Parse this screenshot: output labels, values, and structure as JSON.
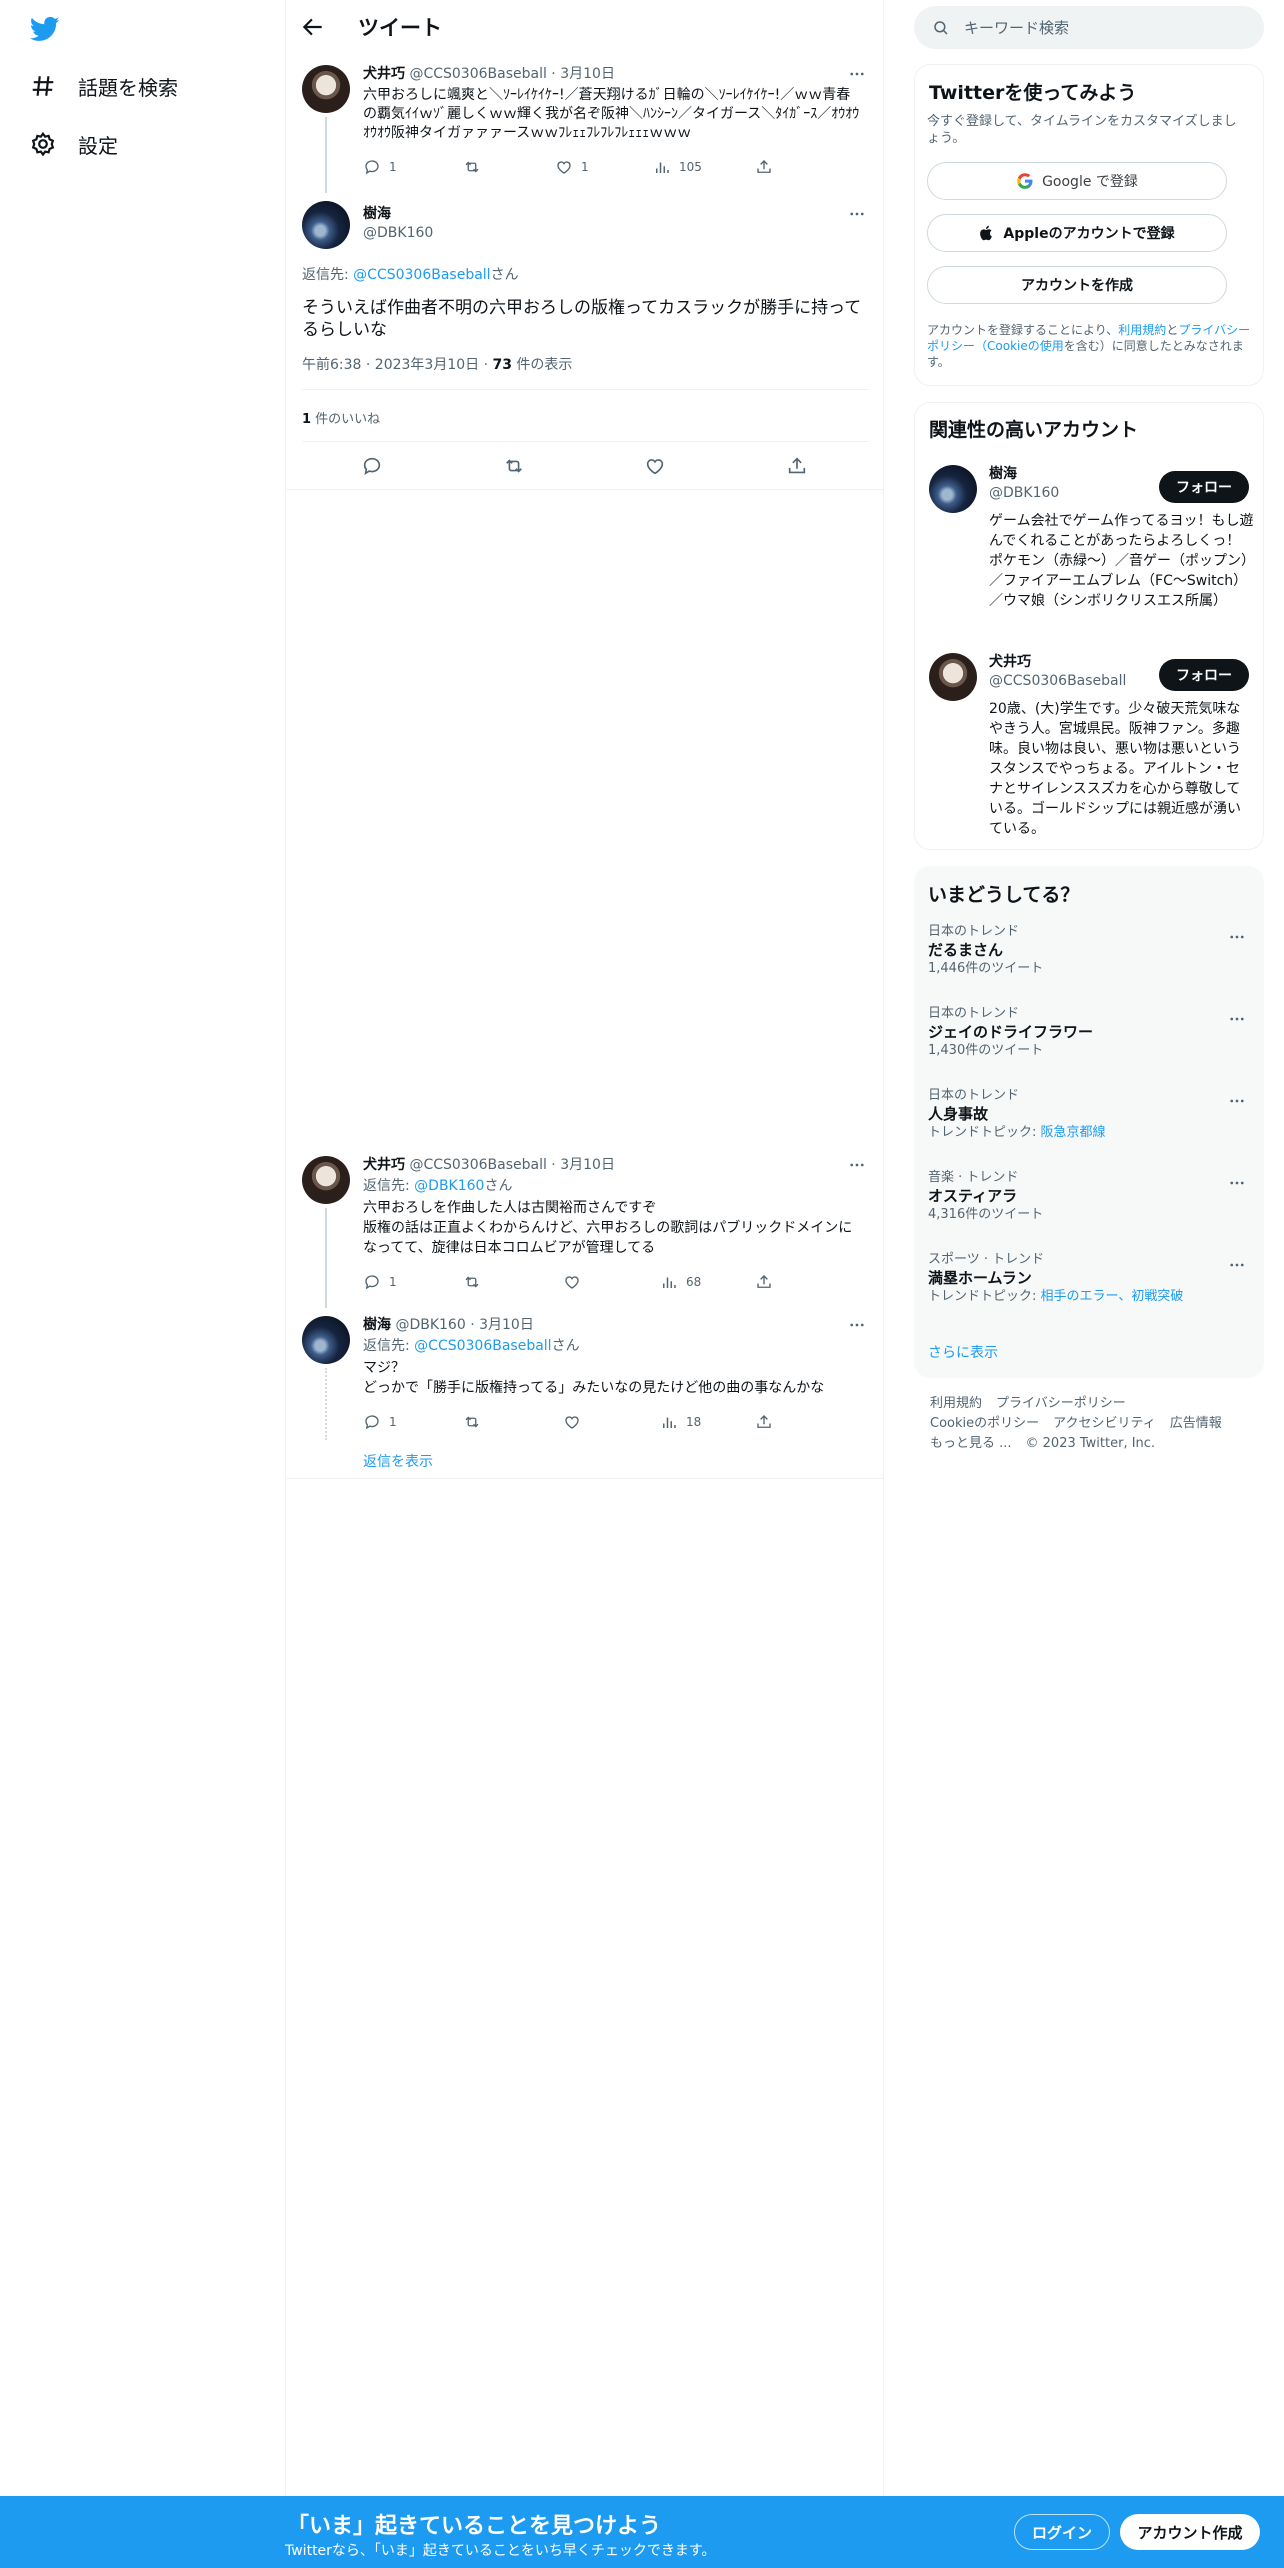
{
  "nav": {
    "search_label": "話題を検索",
    "settings_label": "設定"
  },
  "header": {
    "title": "ツイート"
  },
  "search": {
    "placeholder": "キーワード検索"
  },
  "parent_tweet": {
    "name": "犬井巧",
    "handle": "@CCS0306Baseball",
    "date": "3月10日",
    "text": "六甲おろしに颯爽と＼ｿｰﾚｲｹｲｹｰ!／蒼天翔けるｶﾞ日輪の＼ｿｰﾚｲｹｲｹｰ!／ｗｗ青春の覇気ｲｲｗｿﾞ麗しくｗｗ輝く我が名ぞ阪神＼ﾊﾝｼｰﾝ／タイガース＼ﾀｲｶﾞｰｽ／ｵｳｵｳｵｳｵｳ阪神タイガァァァースｗｗﾌﾚｪｪﾌﾚﾌﾚﾌﾚｪｪｪｗｗｗ",
    "reply_count": "1",
    "like_count": "1",
    "views": "105"
  },
  "main_tweet": {
    "name": "樹海",
    "handle": "@DBK160",
    "reply_prefix": "返信先: ",
    "reply_to": "@CCS0306Baseball",
    "reply_suffix": "さん",
    "text": "そういえば作曲者不明の六甲おろしの版権ってカスラックが勝手に持ってるらしいな",
    "time": "午前6:38 · 2023年3月10日 · ",
    "views_count": "73",
    "views_label": " 件の表示",
    "likes_count": "1",
    "likes_label": " 件のいいね"
  },
  "replies": [
    {
      "name": "犬井巧",
      "handle": "@CCS0306Baseball",
      "date": "3月10日",
      "reply_prefix": "返信先: ",
      "reply_to": "@DBK160",
      "reply_suffix": "さん",
      "text": "六甲おろしを作曲した人は古関裕而さんですぞ\n版権の話は正直よくわからんけど、六甲おろしの歌詞はパブリックドメインになってて、旋律は日本コロムビアが管理してる",
      "reply_count": "1",
      "views": "68"
    },
    {
      "name": "樹海",
      "handle": "@DBK160",
      "date": "3月10日",
      "reply_prefix": "返信先: ",
      "reply_to": "@CCS0306Baseball",
      "reply_suffix": "さん",
      "text": "マジ？\nどっかで「勝手に版権持ってる」みたいなの見たけど他の曲の事なんかな",
      "reply_count": "1",
      "views": "18"
    }
  ],
  "show_replies": "返信を表示",
  "signup": {
    "title": "Twitterを使ってみよう",
    "subtitle": "今すぐ登録して、タイムラインをカスタマイズしましょう。",
    "google": "Google で登録",
    "apple": "Appleのアカウントで登録",
    "create": "アカウントを作成",
    "legal_1": "アカウントを登録することにより、",
    "legal_terms": "利用規約",
    "legal_and": "と",
    "legal_privacy": "プライバシーポリシー（Cookieの使用",
    "legal_2": "を含む）に同意したとみなされます。"
  },
  "relevant": {
    "title": "関連性の高いアカウント",
    "follow_label": "フォロー",
    "accounts": [
      {
        "name": "樹海",
        "handle": "@DBK160",
        "bio": "ゲーム会社でゲーム作ってるヨッ！もし遊んでくれることがあったらよろしくっ！ ポケモン（赤緑〜）／音ゲー（ポップン）／ファイアーエムブレム（FC～Switch）／ウマ娘（シンボリクリスエス所属）"
      },
      {
        "name": "犬井巧",
        "handle": "@CCS0306Baseball",
        "bio": "20歳、(大)学生です。少々破天荒気味なやきう人。宮城県民。阪神ファン。多趣味。良い物は良い、悪い物は悪いというスタンスでやっちょる。アイルトン・セナとサイレンススズカを心から尊敬している。ゴールドシップには親近感が湧いている。"
      }
    ]
  },
  "trends": {
    "title": "いまどうしてる？",
    "items": [
      {
        "category": "日本のトレンド",
        "name": "だるまさん",
        "sub": "1,446件のツイート"
      },
      {
        "category": "日本のトレンド",
        "name": "ジェイのドライフラワー",
        "sub": "1,430件のツイート"
      },
      {
        "category": "日本のトレンド",
        "name": "人身事故",
        "sub_prefix": "トレンドトピック: ",
        "sub_link": "阪急京都線"
      },
      {
        "category": "音楽 · トレンド",
        "name": "オスティアラ",
        "sub": "4,316件のツイート"
      },
      {
        "category": "スポーツ · トレンド",
        "name": "満塁ホームラン",
        "sub_prefix": "トレンドトピック: ",
        "sub_link": "相手のエラー、初戦突破"
      }
    ],
    "show_more": "さらに表示"
  },
  "footer": {
    "terms": "利用規約",
    "privacy": "プライバシーポリシー",
    "cookie": "Cookieのポリシー",
    "accessibility": "アクセシビリティ",
    "ads": "広告情報",
    "more": "もっと見る ...",
    "copyright": "© 2023 Twitter, Inc."
  },
  "banner": {
    "title": "「いま」起きていることを見つけよう",
    "subtitle": "Twitterなら、「いま」起きていることをいち早くチェックできます。",
    "login": "ログイン",
    "signup": "アカウント作成"
  },
  "colors": {
    "accent": "#1d9bf0",
    "text": "#0f1419",
    "secondary": "#536471"
  }
}
